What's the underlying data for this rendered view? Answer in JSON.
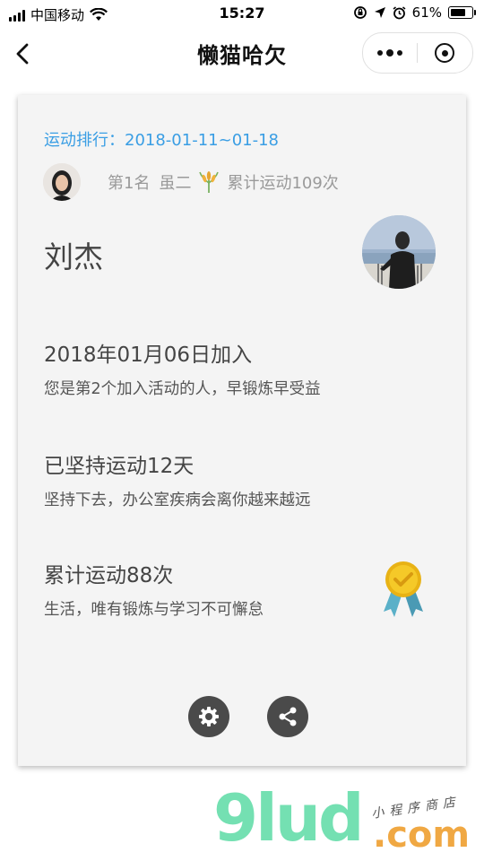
{
  "status_bar": {
    "carrier": "中国移动",
    "time": "15:27",
    "battery": "61%"
  },
  "nav": {
    "title": "懒猫哈欠"
  },
  "card": {
    "rank_title": "运动排行：2018-01-11~01-18",
    "rank_position": "第1名",
    "rank_user": "虽二",
    "rank_total": "累计运动109次",
    "user_name": "刘杰",
    "join": {
      "title": "2018年01月06日加入",
      "desc": "您是第2个加入活动的人，早锻炼早受益"
    },
    "persist": {
      "title": "已坚持运动12天",
      "desc": "坚持下去，办公室疾病会离你越来越远"
    },
    "total": {
      "title": "累计运动88次",
      "desc": "生活，唯有锻炼与学习不可懈怠"
    }
  },
  "watermark": {
    "brand": "9lud",
    "domain": ".com",
    "subtitle": "小程序商店"
  },
  "colors": {
    "accent": "#3a9ee4",
    "card_bg": "#f4f4f4",
    "button_bg": "#4a4a4a",
    "medal": "#f2c21b",
    "ribbon": "#5ab0c8"
  },
  "icons": [
    "signal-icon",
    "wifi-icon",
    "lock-rotation-icon",
    "location-icon",
    "alarm-icon",
    "battery-icon",
    "back-icon",
    "more-icon",
    "close-icon",
    "wheat-icon",
    "medal-icon",
    "settings-icon",
    "share-icon"
  ]
}
